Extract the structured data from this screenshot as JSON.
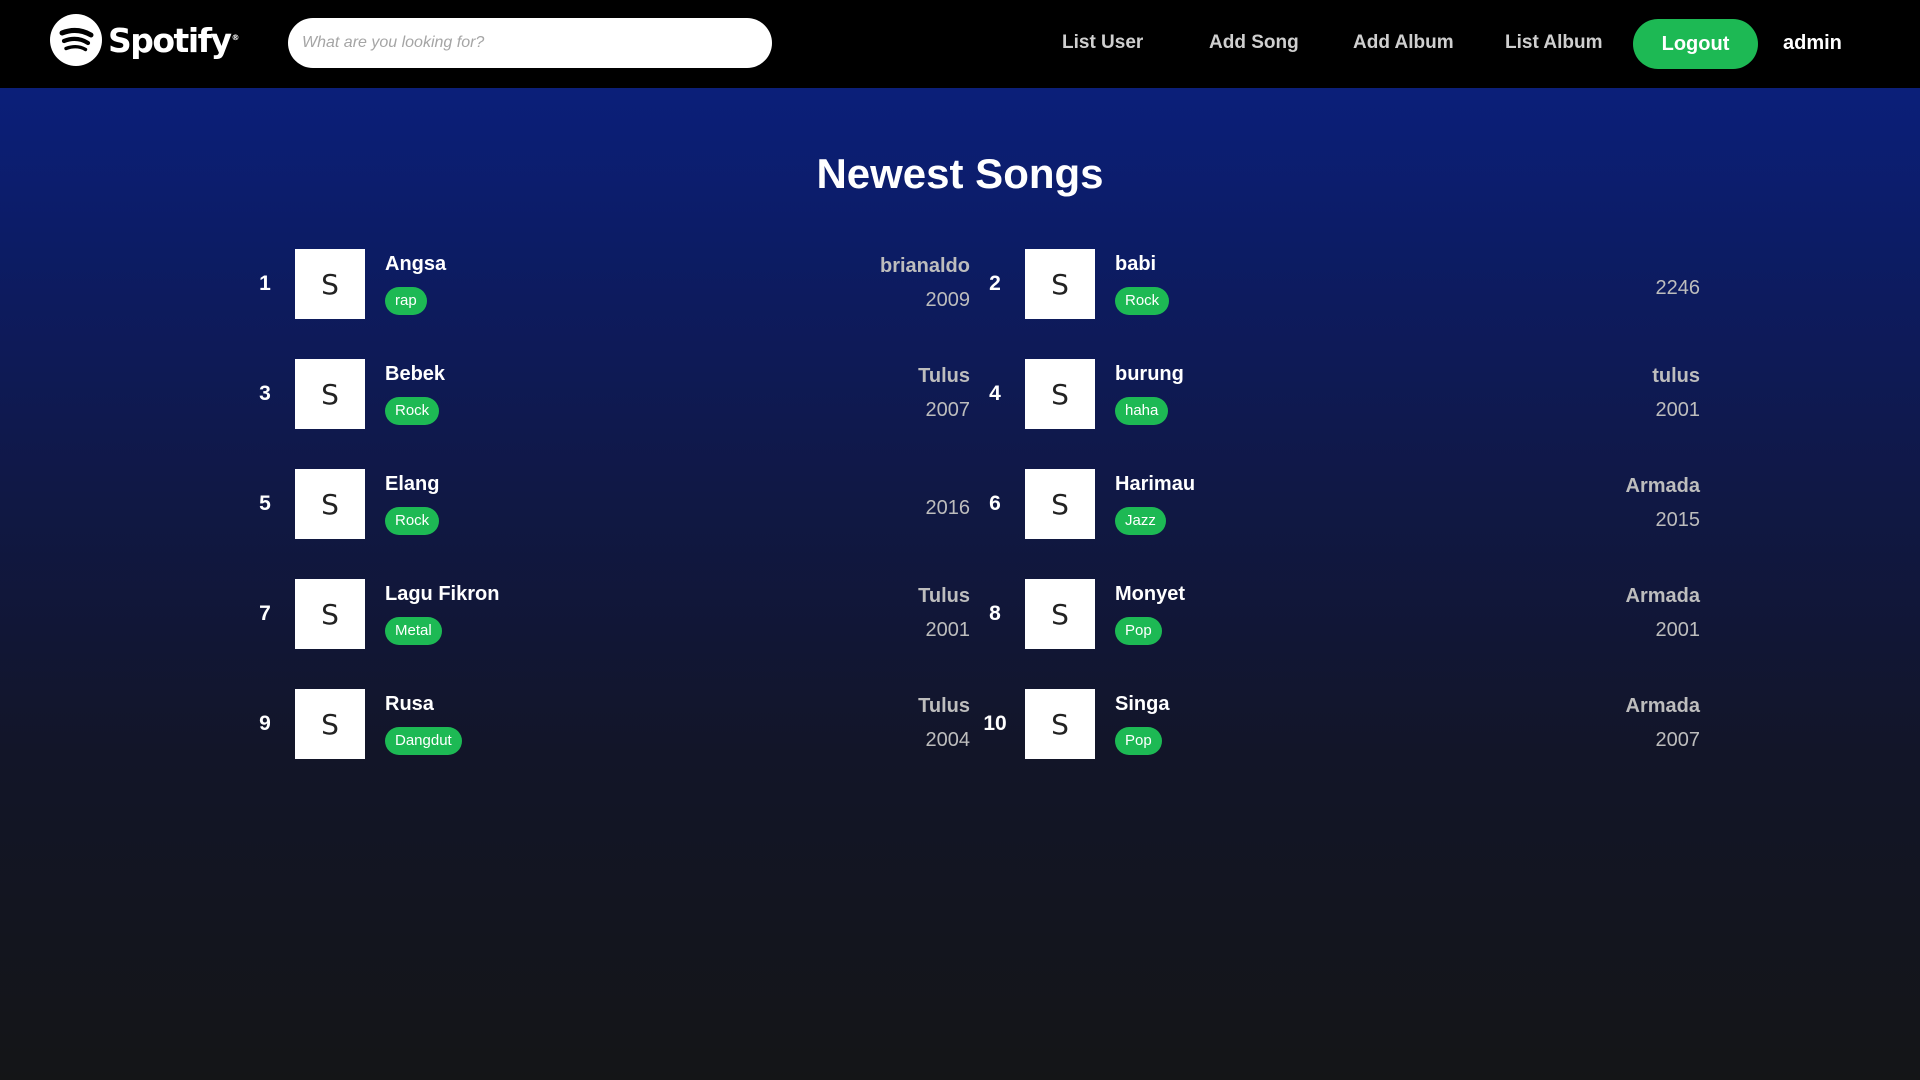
{
  "app": {
    "logo_text": "Spotify",
    "logo_reg": "®"
  },
  "search": {
    "placeholder": "What are you looking for?",
    "value": ""
  },
  "nav": {
    "list_user": "List User",
    "add_song": "Add Song",
    "add_album": "Add Album",
    "list_album": "List Album",
    "logout": "Logout",
    "user": "admin"
  },
  "main": {
    "title": "Newest Songs",
    "songs": [
      {
        "num": "1",
        "thumb": "S",
        "title": "Angsa",
        "genre": "rap",
        "artist": "brianaldo",
        "year": "2009"
      },
      {
        "num": "2",
        "thumb": "S",
        "title": "babi",
        "genre": "Rock",
        "artist": "",
        "year": "2246"
      },
      {
        "num": "3",
        "thumb": "S",
        "title": "Bebek",
        "genre": "Rock",
        "artist": "Tulus",
        "year": "2007"
      },
      {
        "num": "4",
        "thumb": "S",
        "title": "burung",
        "genre": "haha",
        "artist": "tulus",
        "year": "2001"
      },
      {
        "num": "5",
        "thumb": "S",
        "title": "Elang",
        "genre": "Rock",
        "artist": "",
        "year": "2016"
      },
      {
        "num": "6",
        "thumb": "S",
        "title": "Harimau",
        "genre": "Jazz",
        "artist": "Armada",
        "year": "2015"
      },
      {
        "num": "7",
        "thumb": "S",
        "title": "Lagu Fikron",
        "genre": "Metal",
        "artist": "Tulus",
        "year": "2001"
      },
      {
        "num": "8",
        "thumb": "S",
        "title": "Monyet",
        "genre": "Pop",
        "artist": "Armada",
        "year": "2001"
      },
      {
        "num": "9",
        "thumb": "S",
        "title": "Rusa",
        "genre": "Dangdut",
        "artist": "Tulus",
        "year": "2004"
      },
      {
        "num": "10",
        "thumb": "S",
        "title": "Singa",
        "genre": "Pop",
        "artist": "Armada",
        "year": "2007"
      }
    ]
  },
  "colors": {
    "accent": "#1db954",
    "navbar": "#000000",
    "gradient_top": "#0a2185",
    "gradient_bottom": "#141517"
  },
  "icons": {
    "logo": "spotify-logo-icon"
  }
}
